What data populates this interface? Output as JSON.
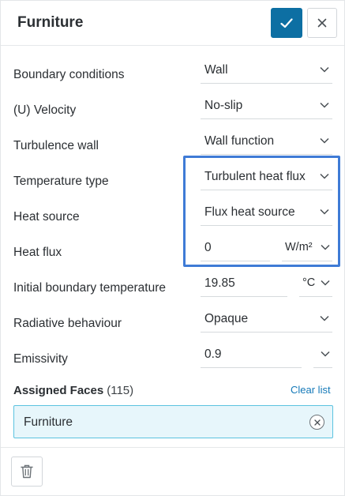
{
  "header": {
    "title": "Furniture",
    "confirm_icon": "check-icon",
    "close_icon": "close-icon"
  },
  "fields": [
    {
      "label": "Boundary conditions",
      "value": "Wall"
    },
    {
      "label": "(U) Velocity",
      "value": "No-slip"
    },
    {
      "label": "Turbulence wall",
      "value": "Wall function"
    },
    {
      "label": "Temperature type",
      "value": "Turbulent heat flux"
    },
    {
      "label": "Heat source",
      "value": "Flux heat source"
    },
    {
      "label": "Heat flux",
      "value": "0",
      "unit": "W/m²"
    },
    {
      "label": "Initial boundary temperature",
      "value": "19.85",
      "unit": "°C"
    },
    {
      "label": "Radiative behaviour",
      "value": "Opaque"
    },
    {
      "label": "Emissivity",
      "value": "0.9"
    }
  ],
  "assigned": {
    "title": "Assigned Faces",
    "count": "(115)",
    "clear_label": "Clear list",
    "items": [
      "Furniture"
    ]
  },
  "footer": {
    "delete_icon": "trash-icon"
  },
  "colors": {
    "primary": "#0d6fa3",
    "highlight": "#3f7bd6",
    "chip_bg": "#e7f6fb",
    "chip_border": "#5cc3e0",
    "link": "#1479b8"
  }
}
